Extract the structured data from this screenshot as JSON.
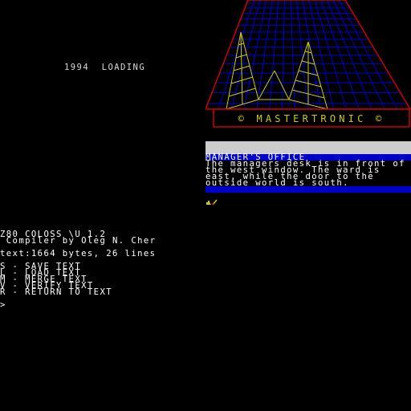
{
  "loading": {
    "text": "1994  LOADING"
  },
  "logo": {
    "brand": "© MASTERTRONIC ©"
  },
  "game": {
    "room_title": "MANAGER'S OFFICE",
    "description": [
      "The managers desk is in front of",
      "the west window. The ward is",
      "east, while the door to the",
      "outside world is south."
    ]
  },
  "editor": {
    "title": "Z80 COLOSS \\U 1.2",
    "credit": " Compiler by Oleg N. Cher",
    "stats": "text:1664 bytes, 26 lines",
    "menu": [
      "S - SAVE TEXT",
      "L - LOAD TEXT",
      "M - MERGE TEXT",
      "V - VERIFY TEXT",
      "R - RETURN TO TEXT"
    ],
    "prompt": ">"
  },
  "colors": {
    "background": "#000000",
    "grid_blue": "#0000cd",
    "logo_red": "#cd0000",
    "logo_yellow": "#cdcd00",
    "panel_grey": "#cdcdcd"
  }
}
